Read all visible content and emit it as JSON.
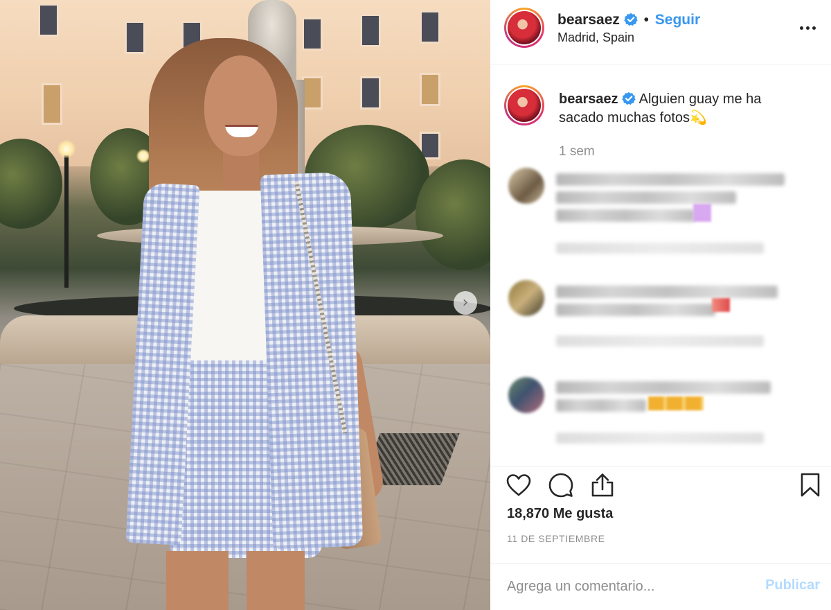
{
  "post": {
    "username": "bearsaez",
    "follow_label": "Seguir",
    "separator": "•",
    "location": "Madrid, Spain",
    "caption_text": "Alguien guay me ha sacado muchas fotos",
    "caption_emoji": "💫",
    "time_ago": "1 sem",
    "likes_label": "18,870 Me gusta",
    "date_label": "11 DE SEPTIEMBRE"
  },
  "comment_form": {
    "placeholder": "Agrega un comentario...",
    "publish_label": "Publicar"
  },
  "icons": {
    "carousel_next": "chevron-right-icon",
    "more": "more-options-icon",
    "verified": "verified-badge-icon",
    "like": "heart-icon",
    "comment": "comment-icon",
    "share": "share-icon",
    "save": "bookmark-icon"
  },
  "colors": {
    "accent_blue": "#3897f0",
    "verified_blue": "#3897f0",
    "publish_disabled": "#b3dbff",
    "secondary_text": "#8e8e8e",
    "primary_text": "#262626"
  }
}
